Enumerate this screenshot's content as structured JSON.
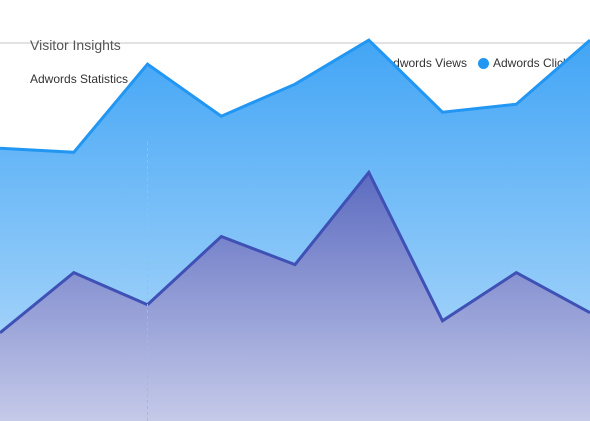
{
  "header": {
    "title": "Visitor Insights",
    "subtitle": "Adwords Statistics"
  },
  "legend": {
    "items": [
      {
        "label": "Adwords Views",
        "color": "#3f51b5"
      },
      {
        "label": "Adwords Clicks",
        "color": "#2196f3"
      }
    ]
  },
  "chart_data": {
    "type": "area",
    "title": "",
    "xlabel": "",
    "ylabel": "",
    "grid": false,
    "legend_position": "top-right",
    "x": [
      0,
      1,
      2,
      3,
      4,
      5,
      6,
      7,
      8
    ],
    "ylim": [
      0,
      100
    ],
    "series": [
      {
        "name": "Adwords Clicks",
        "color": "#2196f3",
        "values": [
          68,
          67,
          89,
          76,
          84,
          95,
          77,
          79,
          95
        ]
      },
      {
        "name": "Adwords Views",
        "color": "#3f51b5",
        "values": [
          22,
          37,
          29,
          46,
          39,
          62,
          25,
          37,
          27
        ]
      }
    ],
    "crosshair_index": 2
  }
}
